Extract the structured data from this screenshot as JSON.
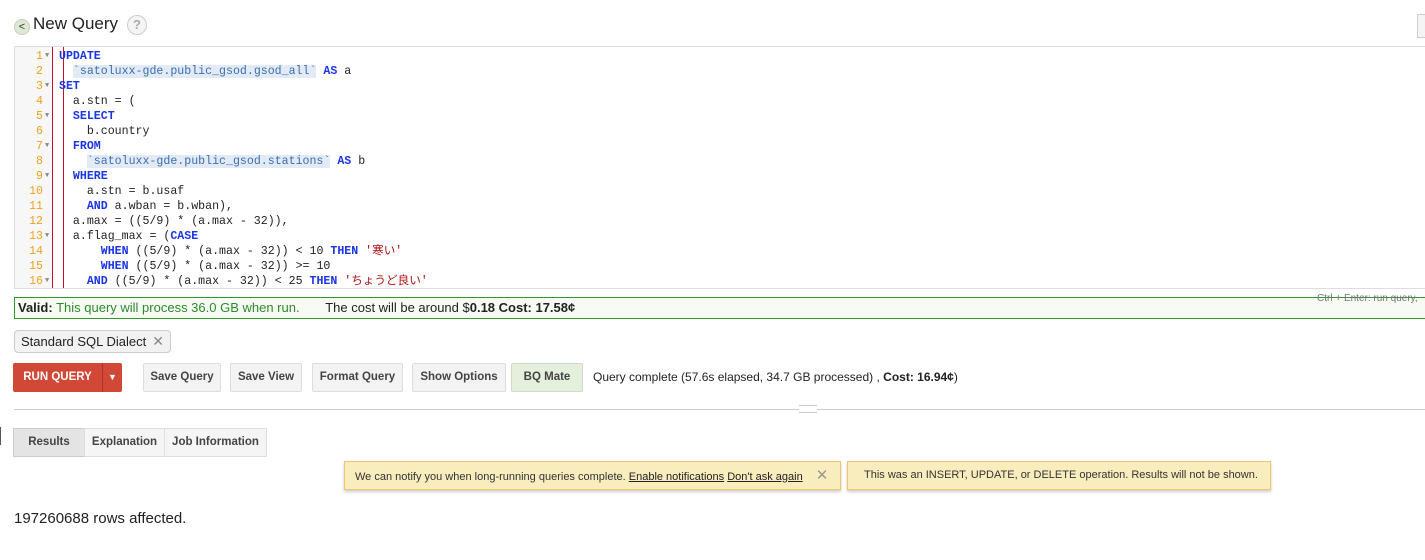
{
  "header": {
    "back_icon": "<",
    "title": "New Query",
    "help_icon": "?"
  },
  "editor": {
    "lines": [
      {
        "n": "1",
        "fold": true,
        "segs": [
          {
            "t": "UPDATE",
            "c": "kw"
          }
        ]
      },
      {
        "n": "2",
        "fold": false,
        "segs": [
          {
            "t": "  ",
            "c": ""
          },
          {
            "t": "`satoluxx-gde.public_gsod.gsod_all`",
            "c": "str"
          },
          {
            "t": " ",
            "c": ""
          },
          {
            "t": "AS",
            "c": "kw"
          },
          {
            "t": " a",
            "c": ""
          }
        ]
      },
      {
        "n": "3",
        "fold": true,
        "segs": [
          {
            "t": "SET",
            "c": "kw"
          }
        ]
      },
      {
        "n": "4",
        "fold": false,
        "segs": [
          {
            "t": "  a.stn = (",
            "c": ""
          }
        ]
      },
      {
        "n": "5",
        "fold": true,
        "segs": [
          {
            "t": "  ",
            "c": ""
          },
          {
            "t": "SELECT",
            "c": "kw"
          }
        ]
      },
      {
        "n": "6",
        "fold": false,
        "segs": [
          {
            "t": "    b.country",
            "c": ""
          }
        ]
      },
      {
        "n": "7",
        "fold": true,
        "segs": [
          {
            "t": "  ",
            "c": ""
          },
          {
            "t": "FROM",
            "c": "kw"
          }
        ]
      },
      {
        "n": "8",
        "fold": false,
        "segs": [
          {
            "t": "    ",
            "c": ""
          },
          {
            "t": "`satoluxx-gde.public_gsod.stations`",
            "c": "str"
          },
          {
            "t": " ",
            "c": ""
          },
          {
            "t": "AS",
            "c": "kw"
          },
          {
            "t": " b",
            "c": ""
          }
        ]
      },
      {
        "n": "9",
        "fold": true,
        "segs": [
          {
            "t": "  ",
            "c": ""
          },
          {
            "t": "WHERE",
            "c": "kw"
          }
        ]
      },
      {
        "n": "10",
        "fold": false,
        "segs": [
          {
            "t": "    a.stn = b.usaf",
            "c": ""
          }
        ]
      },
      {
        "n": "11",
        "fold": false,
        "segs": [
          {
            "t": "    ",
            "c": ""
          },
          {
            "t": "AND",
            "c": "kw"
          },
          {
            "t": " a.wban = b.wban),",
            "c": ""
          }
        ]
      },
      {
        "n": "12",
        "fold": false,
        "segs": [
          {
            "t": "  a.max = ((5/9) * (a.max - 32)),",
            "c": ""
          }
        ]
      },
      {
        "n": "13",
        "fold": true,
        "segs": [
          {
            "t": "  a.flag_max = (",
            "c": ""
          },
          {
            "t": "CASE",
            "c": "kw"
          }
        ]
      },
      {
        "n": "14",
        "fold": false,
        "segs": [
          {
            "t": "      ",
            "c": ""
          },
          {
            "t": "WHEN",
            "c": "kw"
          },
          {
            "t": " ((5/9) * (a.max - 32)) < 10 ",
            "c": ""
          },
          {
            "t": "THEN",
            "c": "kw"
          },
          {
            "t": " '寒い'",
            "c": "jp"
          }
        ]
      },
      {
        "n": "15",
        "fold": false,
        "segs": [
          {
            "t": "      ",
            "c": ""
          },
          {
            "t": "WHEN",
            "c": "kw"
          },
          {
            "t": " ((5/9) * (a.max - 32)) >= 10",
            "c": ""
          }
        ]
      },
      {
        "n": "16",
        "fold": true,
        "segs": [
          {
            "t": "    ",
            "c": ""
          },
          {
            "t": "AND",
            "c": "kw"
          },
          {
            "t": " ((5/9) * (a.max - 32)) < 25 ",
            "c": ""
          },
          {
            "t": "THEN",
            "c": "kw"
          },
          {
            "t": " 'ちょうど良い'",
            "c": "jp"
          }
        ]
      }
    ]
  },
  "validation": {
    "label": "Valid:",
    "message": "This query will process 36.0 GB when run.",
    "cost_prefix": "The cost will be around $",
    "cost_value": "0.18 Cost: 17.58¢"
  },
  "shortcut_hint": "Ctrl + Enter: run query,",
  "dialect_chip": {
    "label": "Standard SQL Dialect",
    "close_icon": "✕"
  },
  "toolbar": {
    "run": "RUN QUERY",
    "run_dropdown_icon": "▼",
    "save_query": "Save Query",
    "save_view": "Save View",
    "format_query": "Format Query",
    "show_options": "Show Options",
    "bq_mate": "BQ Mate"
  },
  "status": {
    "text": "Query complete (57.6s elapsed, 34.7 GB processed) , ",
    "cost_label": "Cost: 16.94¢",
    "close": ")"
  },
  "tabs": [
    "Results",
    "Explanation",
    "Job Information"
  ],
  "notices": {
    "notify_text": "We can notify you when long-running queries complete.",
    "enable": "Enable notifications",
    "dont_ask": "Don't ask again",
    "close_icon": "✕",
    "dml_text": "This was an INSERT, UPDATE, or DELETE operation. Results will not be shown."
  },
  "result": {
    "rows_affected": "197260688 rows affected."
  }
}
